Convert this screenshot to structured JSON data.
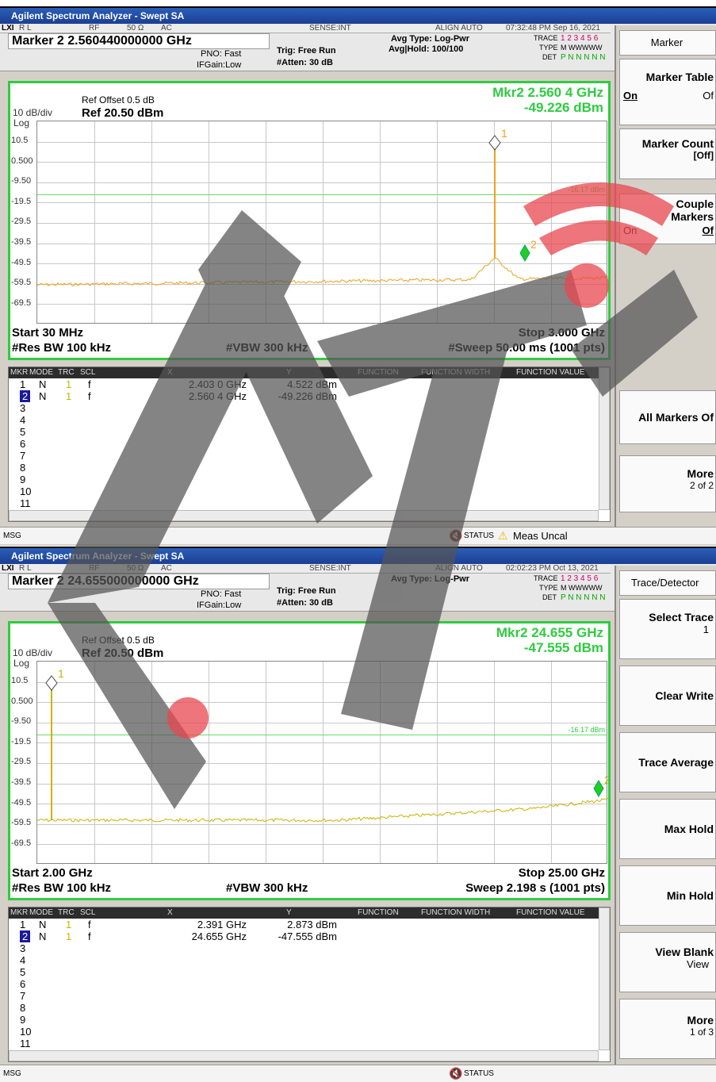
{
  "app_title": "Agilent Spectrum Analyzer - Swept SA",
  "top": {
    "rl": "R L",
    "rf": "RF",
    "imp": "50 Ω",
    "ac": "AC",
    "sense": "SENSE:INT",
    "align": "ALIGN AUTO",
    "datetime": "07:32:48 PM Sep 16, 2021",
    "marker_title": "Marker 2 2.560440000000 GHz",
    "pno": "PNO: Fast",
    "ifgain": "IFGain:Low",
    "trig": "Trig: Free Run",
    "atten": "#Atten: 30 dB",
    "avg_type": "Avg Type: Log-Pwr",
    "avg_hold": "Avg|Hold: 100/100",
    "trace_label": "TRACE",
    "trace_nums": "1 2 3 4 5 6",
    "type_label": "TYPE",
    "type_val": "M WWWWW",
    "det_label": "DET",
    "det_val": "P N N N N N",
    "ref_offset": "Ref Offset 0.5 dB",
    "scale": "10 dB/div",
    "log": "Log",
    "ref": "Ref 20.50 dBm",
    "mkr_freq": "Mkr2 2.560 4 GHz",
    "mkr_amp": "-49.226 dBm",
    "y_ticks": [
      "10.5",
      "0.500",
      "-9.50",
      "-19.5",
      "-29.5",
      "-39.5",
      "-49.5",
      "-59.5",
      "-69.5"
    ],
    "limit_label": "-16.17 dBm",
    "start": "Start 30 MHz",
    "stop": "Stop 3.000 GHz",
    "rbw": "#Res BW 100 kHz",
    "vbw": "#VBW 300 kHz",
    "sweep": "#Sweep  50.00 ms (1001 pts)",
    "marker1_label": "1",
    "marker2_label": "2",
    "table_headers": [
      "MKR",
      "MODE",
      "TRC",
      "SCL",
      "X",
      "Y",
      "FUNCTION",
      "FUNCTION WIDTH",
      "FUNCTION VALUE"
    ],
    "rows": [
      {
        "n": "1",
        "mode": "N",
        "trc": "1",
        "scl": "f",
        "x": "2.403 0 GHz",
        "y": "4.522 dBm"
      },
      {
        "n": "2",
        "mode": "N",
        "trc": "1",
        "scl": "f",
        "x": "2.560 4 GHz",
        "y": "-49.226 dBm"
      },
      {
        "n": "3"
      },
      {
        "n": "4"
      },
      {
        "n": "5"
      },
      {
        "n": "6"
      },
      {
        "n": "7"
      },
      {
        "n": "8"
      },
      {
        "n": "9"
      },
      {
        "n": "10"
      },
      {
        "n": "11"
      }
    ],
    "msg": "MSG",
    "status": "STATUS",
    "meas_uncal": "Meas Uncal",
    "softkeys": {
      "menu_title": "Marker",
      "marker_table": "Marker Table",
      "mt_on": "On",
      "mt_off": "Of",
      "marker_count": "Marker Count",
      "mc_state": "[Off]",
      "couple": "Couple",
      "markers": "Markers",
      "cm_on": "On",
      "cm_off": "Of",
      "all_off": "All Markers Of",
      "more": "More",
      "more_page": "2 of 2"
    }
  },
  "bottom": {
    "rl": "R L",
    "rf": "RF",
    "imp": "50 Ω",
    "ac": "AC",
    "sense": "SENSE:INT",
    "align": "ALIGN AUTO",
    "datetime": "02:02:23 PM Oct 13, 2021",
    "marker_title": "Marker 2 24.655000000000 GHz",
    "pno": "PNO: Fast",
    "ifgain": "IFGain:Low",
    "trig": "Trig: Free Run",
    "atten": "#Atten: 30 dB",
    "avg_type": "Avg Type: Log-Pwr",
    "trace_label": "TRACE",
    "trace_nums": "1 2 3 4 5 6",
    "type_label": "TYPE",
    "type_val": "M WWWWW",
    "det_label": "DET",
    "det_val": "P N N N N N",
    "ref_offset": "Ref Offset 0.5 dB",
    "scale": "10 dB/div",
    "log": "Log",
    "ref": "Ref 20.50 dBm",
    "mkr_freq": "Mkr2 24.655 GHz",
    "mkr_amp": "-47.555 dBm",
    "y_ticks": [
      "10.5",
      "0.500",
      "-9.50",
      "-19.5",
      "-29.5",
      "-39.5",
      "-49.5",
      "-59.5",
      "-69.5"
    ],
    "limit_label": "-16.17 dBm",
    "start": "Start 2.00 GHz",
    "stop": "Stop 25.00 GHz",
    "rbw": "#Res BW 100 kHz",
    "vbw": "#VBW 300 kHz",
    "sweep": "Sweep  2.198 s (1001 pts)",
    "marker1_label": "1",
    "marker2_label": "2",
    "table_headers": [
      "MKR",
      "MODE",
      "TRC",
      "SCL",
      "X",
      "Y",
      "FUNCTION",
      "FUNCTION WIDTH",
      "FUNCTION VALUE"
    ],
    "rows": [
      {
        "n": "1",
        "mode": "N",
        "trc": "1",
        "scl": "f",
        "x": "2.391 GHz",
        "y": "2.873 dBm"
      },
      {
        "n": "2",
        "mode": "N",
        "trc": "1",
        "scl": "f",
        "x": "24.655 GHz",
        "y": "-47.555 dBm"
      },
      {
        "n": "3"
      },
      {
        "n": "4"
      },
      {
        "n": "5"
      },
      {
        "n": "6"
      },
      {
        "n": "7"
      },
      {
        "n": "8"
      },
      {
        "n": "9"
      },
      {
        "n": "10"
      },
      {
        "n": "11"
      }
    ],
    "msg": "MSG",
    "status": "STATUS",
    "softkeys": {
      "menu_title": "Trace/Detector",
      "select_trace": "Select Trace",
      "st_val": "1",
      "clear_write": "Clear Write",
      "trace_average": "Trace Average",
      "max_hold": "Max Hold",
      "min_hold": "Min Hold",
      "view_blank": "View Blank",
      "vb_val": "View",
      "more": "More",
      "more_page": "1 of 3"
    }
  },
  "colors": {
    "screen_border": "#2ecc40",
    "trace_top": "#f0a020",
    "trace_bottom": "#c8b400",
    "marker_diamond": "#22cc22",
    "limit_line": "#66dd66",
    "watermark_gray": "#555555",
    "watermark_red": "#e8474f"
  }
}
